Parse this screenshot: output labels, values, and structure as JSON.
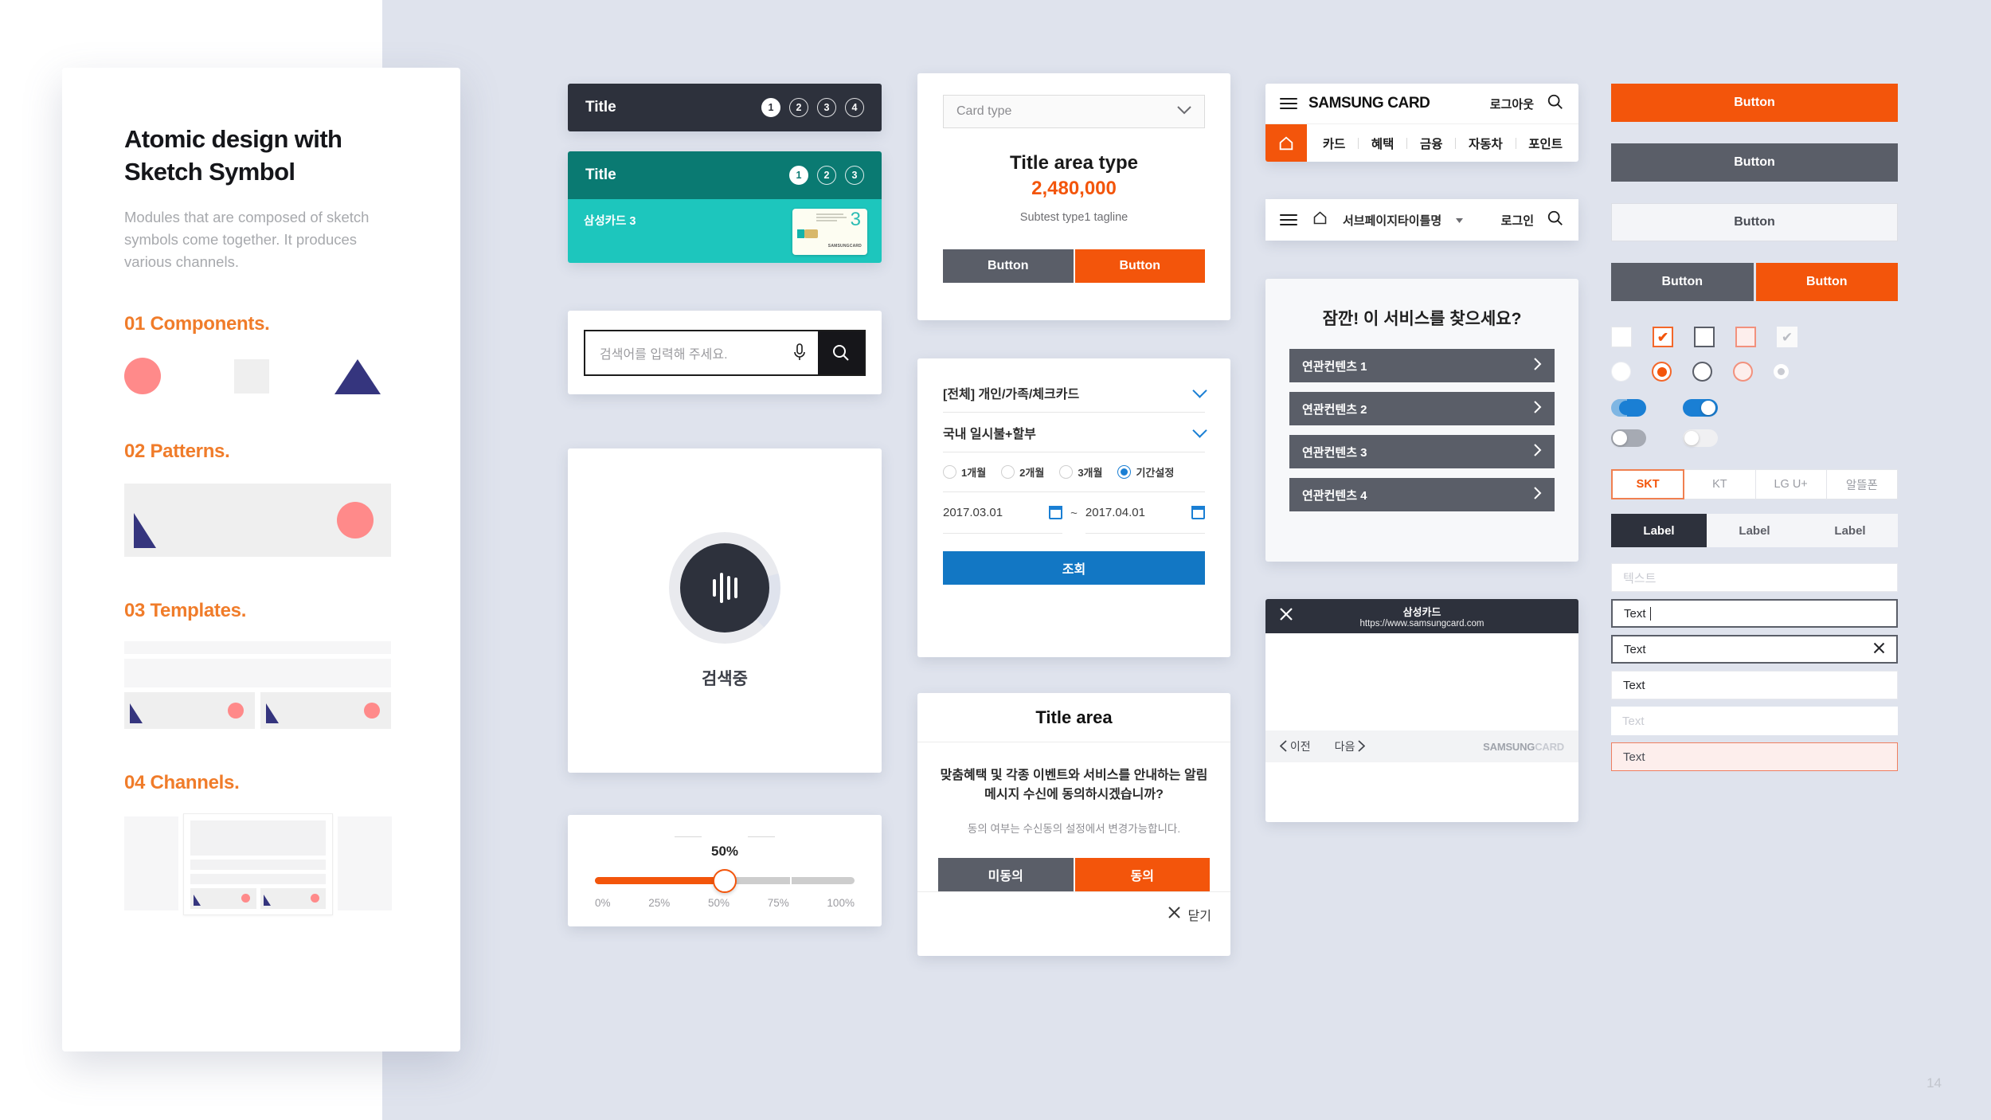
{
  "intro": {
    "title": "Atomic design with Sketch Symbol",
    "description": "Modules that are composed of sketch symbols come together. It produces various channels.",
    "sections": [
      {
        "heading": "01 Components."
      },
      {
        "heading": "02 Patterns."
      },
      {
        "heading": "03 Templates."
      },
      {
        "heading": "04 Channels."
      }
    ]
  },
  "column2": {
    "title_bar_dark": {
      "title": "Title",
      "steps": [
        "1",
        "2",
        "3",
        "4"
      ],
      "active_step": "1"
    },
    "title_bar_teal": {
      "title": "Title",
      "steps": [
        "1",
        "2",
        "3"
      ],
      "active_step": "1",
      "card_name": "삼성카드 3",
      "card_number": "3",
      "card_brand": "SAMSUNGCARD"
    },
    "search": {
      "placeholder": "검색어를 입력해 주세요.",
      "mic_icon": "microphone-icon",
      "search_icon": "search-icon"
    },
    "loading": {
      "label": "검색중",
      "icon": "equalizer-icon"
    },
    "slider": {
      "value_label": "50%",
      "value": 50,
      "ticks": [
        "0%",
        "25%",
        "50%",
        "75%",
        "100%"
      ]
    }
  },
  "column3": {
    "card_panel": {
      "select_value": "Card type",
      "title": "Title area type",
      "amount": "2,480,000",
      "subtitle": "Subtest type1 tagline",
      "button_secondary": "Button",
      "button_primary": "Button"
    },
    "filter_panel": {
      "select1": "[전체] 개인/가족/체크카드",
      "select2": "국내 일시불+할부",
      "radios": [
        "1개월",
        "2개월",
        "3개월",
        "기간설정"
      ],
      "radio_selected": "기간설정",
      "date_from": "2017.03.01",
      "date_separator": "~",
      "date_to": "2017.04.01",
      "submit": "조회"
    },
    "dialog": {
      "title": "Title area",
      "message": "맞춤혜택 및 각종 이벤트와 서비스를 안내하는 알림메시지 수신에 동의하시겠습니까?",
      "note": "동의 여부는 수신동의 설정에서 변경가능합니다.",
      "button_decline": "미동의",
      "button_accept": "동의",
      "close_label": "닫기"
    }
  },
  "column4": {
    "header_logged_in": {
      "menu_icon": "hamburger-icon",
      "brand": "SAMSUNG CARD",
      "auth": "로그아웃",
      "search_icon": "search-icon",
      "home_icon": "home-icon",
      "nav_items": [
        "카드",
        "혜택",
        "금융",
        "자동차",
        "포인트"
      ]
    },
    "header_subpage": {
      "menu_icon": "hamburger-icon",
      "home_icon": "home-icon",
      "title": "서브페이지타이틀명",
      "dropdown_icon": "caret-down-icon",
      "auth": "로그인",
      "search_icon": "search-icon"
    },
    "recommend": {
      "title": "잠깐! 이 서비스를 찾으세요?",
      "items": [
        "연관컨텐츠 1",
        "연관컨텐츠 2",
        "연관컨텐츠 3",
        "연관컨텐츠 4"
      ]
    },
    "browser": {
      "close_icon": "close-icon",
      "title": "삼성카드",
      "url": "https://www.samsungcard.com",
      "prev": "이전",
      "next": "다음",
      "logo_strong": "SAMSUNG",
      "logo_light": "CARD"
    }
  },
  "column5": {
    "buttons": {
      "primary": "Button",
      "secondary": "Button",
      "ghost": "Button",
      "pair_left": "Button",
      "pair_right": "Button"
    },
    "checkboxes": [
      {
        "state": "empty",
        "checked": false
      },
      {
        "state": "orange-checked",
        "checked": true,
        "mark": "✔"
      },
      {
        "state": "dark-empty",
        "checked": false
      },
      {
        "state": "pink-empty",
        "checked": false
      },
      {
        "state": "disabled-checked",
        "checked": true,
        "mark": "✔"
      }
    ],
    "radios": [
      {
        "state": "empty"
      },
      {
        "state": "orange-selected"
      },
      {
        "state": "dark-empty"
      },
      {
        "state": "pink-empty"
      },
      {
        "state": "disabled"
      }
    ],
    "toggles": [
      {
        "state": "on-partial"
      },
      {
        "state": "on"
      },
      {
        "state": "off"
      },
      {
        "state": "off-light"
      }
    ],
    "carrier_tabs": {
      "items": [
        "SKT",
        "KT",
        "LG U+",
        "알뜰폰"
      ],
      "active": "SKT"
    },
    "label_tabs": {
      "items": [
        "Label",
        "Label",
        "Label"
      ],
      "active_index": 0
    },
    "text_fields": [
      {
        "style": "placeholder",
        "value": "텍스트"
      },
      {
        "style": "focused",
        "value": "Text"
      },
      {
        "style": "clearable",
        "value": "Text",
        "clear_icon": "close-icon"
      },
      {
        "style": "filled",
        "value": "Text"
      },
      {
        "style": "dim",
        "value": "Text"
      },
      {
        "style": "error",
        "value": "Text"
      }
    ]
  },
  "footer": {
    "page_number": "14"
  },
  "colors": {
    "accent_orange": "#f3550b",
    "dark": "#2d313c",
    "gray": "#5a5e68",
    "teal_dark": "#0a7a72",
    "teal": "#1dc6bd",
    "blue": "#1a7fd4",
    "pink": "#ff8a8a",
    "navy": "#35357e",
    "background": "#dfe3ed"
  }
}
